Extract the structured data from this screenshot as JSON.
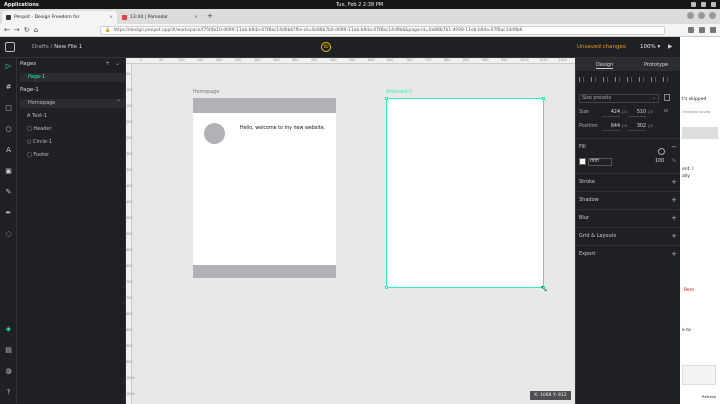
{
  "os": {
    "apps_label": "Applications",
    "clock": "Tue, Feb 2   2:38 PM"
  },
  "browser": {
    "tabs": [
      {
        "title": "Penpot - Design Freedom for",
        "active": true
      },
      {
        "title": "13:44 | Pomodor",
        "active": false
      }
    ],
    "new_tab": "+",
    "url": "https://design.penpot.app/#/workspace/f75f4b10-d099-11eb-b9da-07f8ac14d9b6?file-id=0e86b7b0-d099-11eb-b9da-07f8ac14d9b6&page-id=0e86b7b1-d099-11eb-b9da-07f8ac14d9b6"
  },
  "header": {
    "breadcrumb_project": "Drafts",
    "breadcrumb_sep": "/",
    "breadcrumb_file": "New File 1",
    "view_mode": "00",
    "unsaved": "Unsaved changes",
    "zoom": "100%"
  },
  "layers": {
    "pages_title": "Pages",
    "pages": [
      "Page-1"
    ],
    "current_page": "Page-1",
    "tree": {
      "board": "Homepage",
      "children": [
        "Text-1",
        "Header",
        "Circle-1",
        "Footer"
      ]
    }
  },
  "canvas": {
    "top_ticks": [
      "0",
      "50",
      "100",
      "150",
      "200",
      "250",
      "300",
      "350",
      "400",
      "450",
      "500",
      "550",
      "600",
      "650",
      "700",
      "750",
      "800",
      "850",
      "900",
      "950",
      "1000",
      "1050",
      "1100"
    ],
    "left_ticks": [
      "50",
      "100",
      "150",
      "200",
      "250",
      "300",
      "350",
      "400",
      "450",
      "500",
      "550",
      "600",
      "650",
      "700",
      "750",
      "800",
      "850",
      "900",
      "950",
      "1000",
      "1050"
    ],
    "homepage_label": "Homepage",
    "homepage_text": "Hello, welcome to my new website.",
    "artboard_label": "Artboard-0",
    "coords": "X: 1068  Y: 812"
  },
  "design": {
    "tab_design": "Design",
    "tab_prototype": "Prototype",
    "size_presets": "Size presets",
    "size_label": "Size",
    "width": "424",
    "height": "510",
    "position_label": "Position",
    "x": "644",
    "y": "302",
    "unit": "px",
    "fill_title": "Fill",
    "fill_hex": "ffffff",
    "fill_opacity": "100",
    "opacity_unit": "%",
    "sections": [
      "Stroke",
      "Shadow",
      "Blur",
      "Grid & Layouts",
      "Export"
    ]
  },
  "side": {
    "line1": "t's skipped",
    "line2": "changes saved",
    "line3": "ent. I",
    "line4": "aily",
    "line5": "Rem",
    "line6": "e to",
    "line7": "Refresh"
  }
}
